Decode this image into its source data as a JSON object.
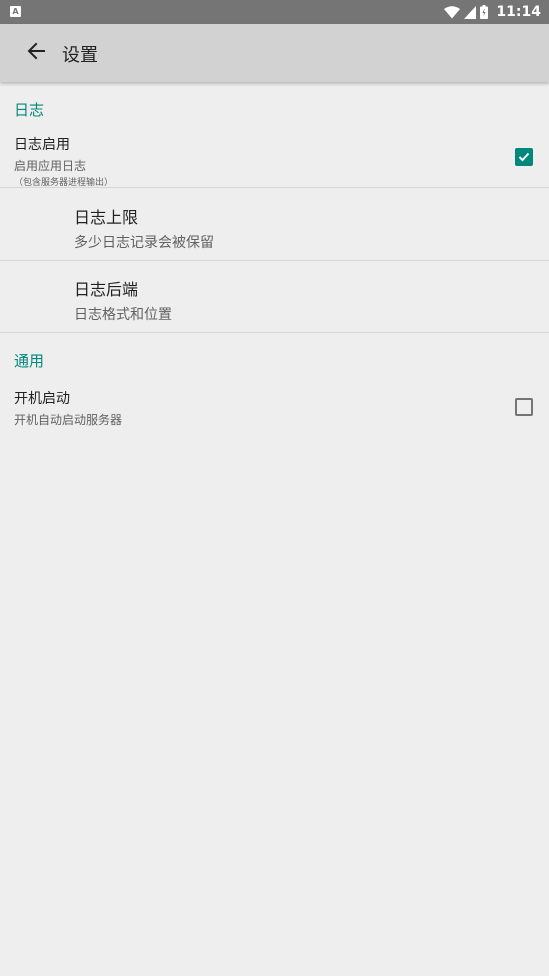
{
  "status_bar": {
    "left_icon_letter": "A",
    "time": "11:14",
    "icons": [
      "wifi-icon",
      "signal-icon",
      "battery-icon"
    ]
  },
  "app_bar": {
    "title": "设置",
    "back_icon": "arrow-left-icon"
  },
  "categories": {
    "log": {
      "title": "日志"
    },
    "general": {
      "title": "通用"
    }
  },
  "prefs": {
    "log_enable": {
      "title": "日志启用",
      "summary": "启用应用日志",
      "summary_note": "（包含服务器进程输出）",
      "checked": true
    },
    "log_limit": {
      "title": "日志上限",
      "summary": "多少日志记录会被保留"
    },
    "log_backend": {
      "title": "日志后端",
      "summary": "日志格式和位置"
    },
    "boot_start": {
      "title": "开机启动",
      "summary": "开机自动启动服务器",
      "checked": false
    }
  },
  "colors": {
    "accent": "#00897b",
    "app_bar": "#d2d2d2",
    "status_bar": "#757575",
    "background": "#eeeeee"
  }
}
